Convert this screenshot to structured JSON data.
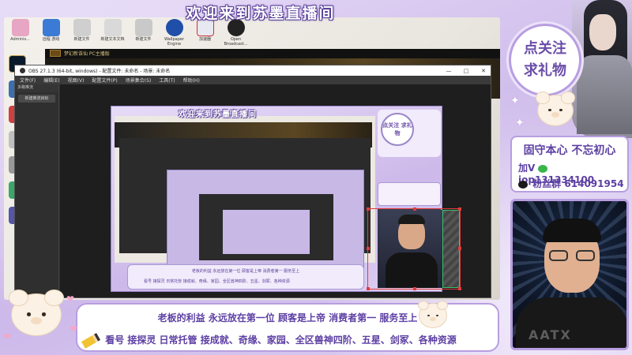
{
  "overlay": {
    "top_title": "欢迎来到苏墨直播间",
    "follow_line1": "点关注",
    "follow_line2": "求礼物",
    "info_title": "固守本心 不忘初心",
    "wechat_label": "加V",
    "wechat_id": "iop131334100",
    "fan_group_label": "粉丝群",
    "fan_group_id": "614091954",
    "bottom_line1": "老板的利益 永远放在第一位 顾客是上帝 消费者第一 服务至上",
    "bottom_line2": "看号  接探灵 日常托管  接成就、奇缘、家园、全区兽神四阶、五星、剑冢、各种资源",
    "shirt_print": "AATX"
  },
  "desktop": {
    "icons": [
      {
        "label": "Adminis..."
      },
      {
        "label": "远程 游戏"
      },
      {
        "label": "新建文件"
      },
      {
        "label": "新建文本文档"
      },
      {
        "label": "新建文件"
      },
      {
        "label": "Wallpaper Engine"
      },
      {
        "label": "加速器"
      },
      {
        "label": "Open Broadcast..."
      }
    ],
    "game_window_title": "梦幻新诛仙 PC主播版"
  },
  "obs": {
    "title": "OBS 27.1.3 (64-bit, windows) - 配置文件: 未命名 - 场景: 未命名",
    "menu": [
      "文件(F)",
      "编辑(E)",
      "视图(V)",
      "配置文件(P)",
      "场景集合(S)",
      "工具(T)",
      "帮助(H)"
    ],
    "left_panel_title": "多路推流",
    "left_panel_button": "新建推流目标",
    "preview_title": "欢迎来到苏墨直播间",
    "preview_follow": "点关注 求礼物",
    "preview_bottom1": "老板的利益 永远放在第一位 顾客是上帝 消费者第一 服务至上",
    "preview_bottom2": "看号 接探灵 日常托管 接成就、奇缘、家园、全区兽神四阶、五星、剑冢、各种资源"
  },
  "colors": {
    "accent": "#5c3fa3",
    "border": "#b79ee0",
    "background": "#d8c9ef"
  }
}
